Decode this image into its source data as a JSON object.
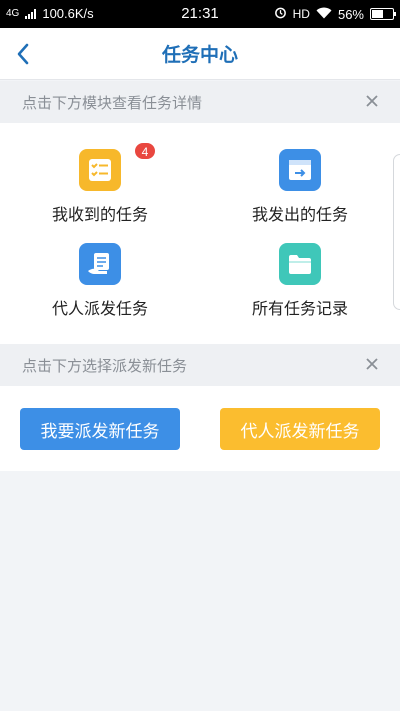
{
  "status_bar": {
    "network": "4G",
    "speed": "100.6K/s",
    "time": "21:31",
    "hd_label": "HD",
    "battery_text": "56%",
    "battery_level": 0.56
  },
  "header": {
    "title": "任务中心",
    "back_icon": "chevron-left-icon"
  },
  "section1": {
    "hint": "点击下方模块查看任务详情",
    "close_icon": "close-icon",
    "items": [
      {
        "label": "我收到的任务",
        "icon": "checklist-icon",
        "color": "#f7b82b",
        "badge": "4"
      },
      {
        "label": "我发出的任务",
        "icon": "send-window-icon",
        "color": "#3d8fe6"
      },
      {
        "label": "代人派发任务",
        "icon": "hand-document-icon",
        "color": "#3d8fe6"
      },
      {
        "label": "所有任务记录",
        "icon": "folder-icon",
        "color": "#3fc7b9"
      }
    ]
  },
  "section2": {
    "hint": "点击下方选择派发新任务",
    "close_icon": "close-icon",
    "buttons": [
      {
        "label": "我要派发新任务",
        "color": "#3d8fe6"
      },
      {
        "label": "代人派发新任务",
        "color": "#fbbd2f"
      }
    ]
  },
  "colors": {
    "accent": "#1f6fb7",
    "badge": "#e9473f",
    "page_background": "#f2f4f7"
  }
}
